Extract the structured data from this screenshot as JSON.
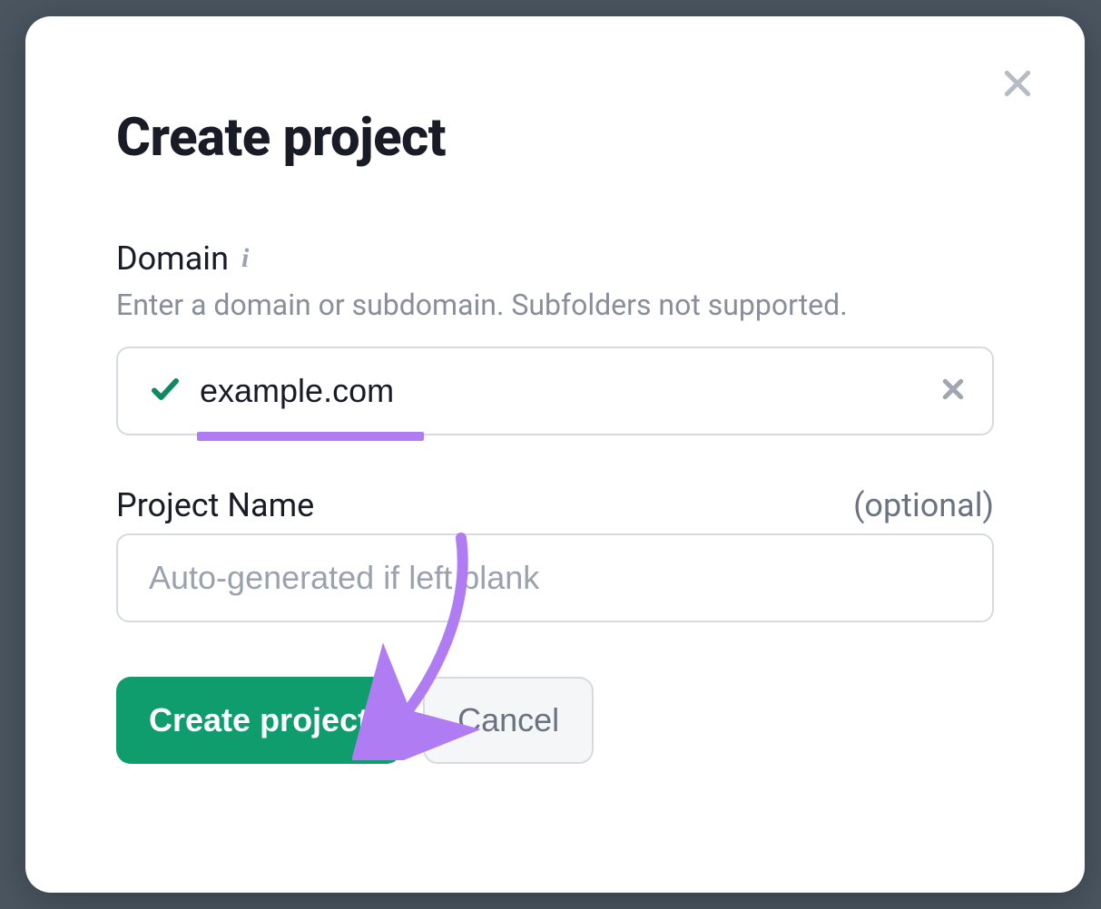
{
  "modal": {
    "title": "Create project",
    "close_aria": "Close"
  },
  "domain_field": {
    "label": "Domain",
    "hint": "Enter a domain or subdomain. Subfolders not supported.",
    "value": "example.com"
  },
  "project_name_field": {
    "label": "Project Name",
    "optional_text": "(optional)",
    "placeholder": "Auto-generated if left blank",
    "value": ""
  },
  "buttons": {
    "create": "Create project",
    "cancel": "Cancel"
  },
  "annotation": {
    "color": "#b07cf4"
  }
}
